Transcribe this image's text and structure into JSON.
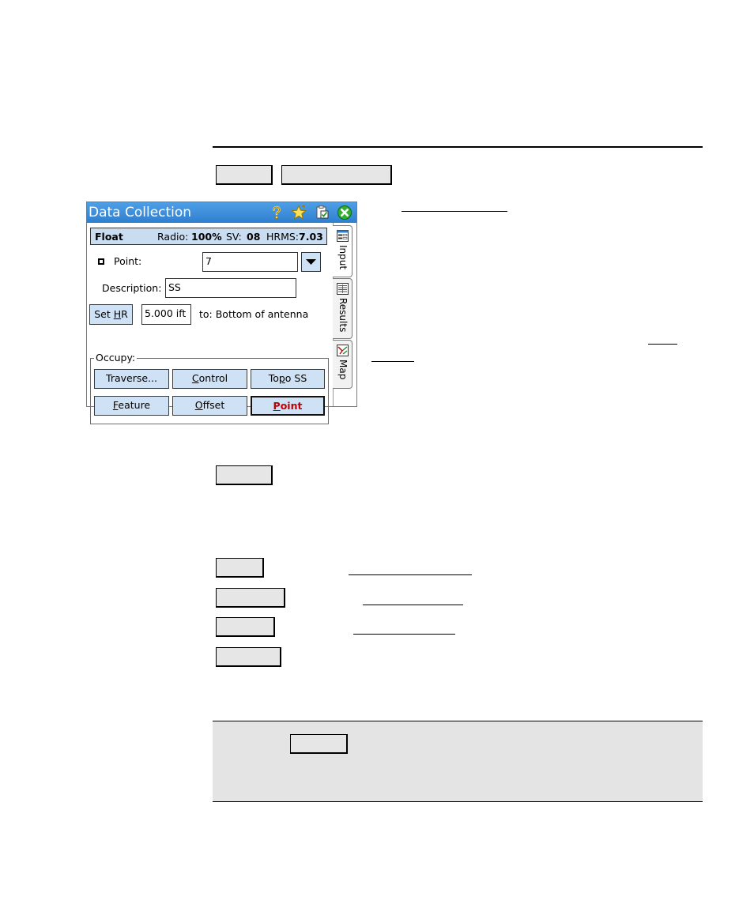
{
  "window": {
    "title": "Data Collection",
    "icons": [
      "help-icon",
      "favorites-star-icon",
      "clipboard-check-icon",
      "close-icon"
    ]
  },
  "status": {
    "fix": "Float",
    "radio_label": "Radio:",
    "radio_value": "100%",
    "sv_label": "SV:",
    "sv_value": "08",
    "hrms_label": "HRMS:",
    "hrms_value": "7.03"
  },
  "point": {
    "label": "Point:",
    "value": "7"
  },
  "description": {
    "label": "Description:",
    "value": "SS"
  },
  "hr": {
    "button": "Set HR",
    "button_mnemonic": "H",
    "value": "5.000 ift",
    "to_label": "to: Bottom of antenna"
  },
  "occupy": {
    "label": "Occupy:",
    "buttons": [
      {
        "label": "Traverse...",
        "mnemonic": ""
      },
      {
        "label": "Control",
        "mnemonic": "C"
      },
      {
        "label": "Topo SS",
        "mnemonic": "p"
      },
      {
        "label": "Feature",
        "mnemonic": "F"
      },
      {
        "label": "Offset",
        "mnemonic": "O"
      },
      {
        "label": "Point",
        "mnemonic": "P"
      }
    ]
  },
  "side_tabs": [
    {
      "label": "Input",
      "icon": "input-form-icon"
    },
    {
      "label": "Results",
      "icon": "results-list-icon"
    },
    {
      "label": "Map",
      "icon": "map-icon"
    }
  ],
  "colors": {
    "titlebar": "#2f7fd0",
    "button_fill": "#cfe2f5",
    "status_fill": "#c9dcf0",
    "point_button_text": "#c00000",
    "note_box": "#e4e4e4",
    "doc_key_fill": "#e6e6e6"
  }
}
